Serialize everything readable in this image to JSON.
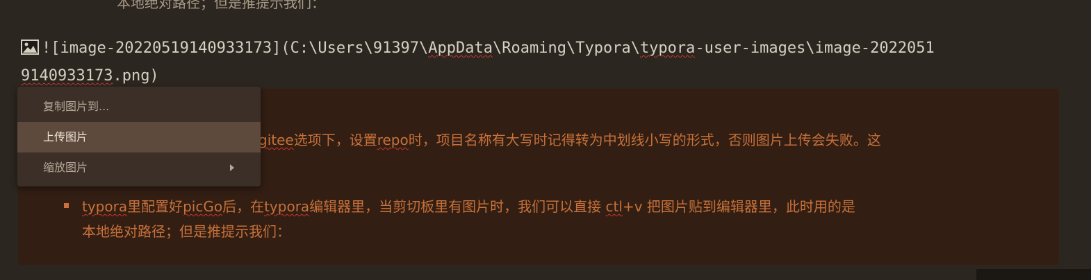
{
  "editor": {
    "top_partial_text": "本地绝对路径；但是推提示我们：",
    "image_source": {
      "icon": "image-icon",
      "line1_a": "![image-20220519140933173](C:\\Users\\91397\\",
      "line1_b": "AppData",
      "line1_c": "\\Roaming\\Typora\\",
      "line1_d": "typora",
      "line1_e": "-user-images\\image-2022051",
      "line2_a": "9140933173",
      "line2_b": ".png)"
    },
    "quote": {
      "line1_a": "gitee",
      "line1_b": "选项下，设置",
      "line1_c": "repo",
      "line1_d": "时，项目名称有大写时记得转为中划线小写的形式，否则图片上传会失败。这"
    },
    "bullet": {
      "line1_a": "typora",
      "line1_b": "里配置好",
      "line1_c": "picGo",
      "line1_d": "后，在",
      "line1_e": "typora",
      "line1_f": "编辑器里，当剪切板里有图片时，我们可以直接 ",
      "line1_g": "ctl",
      "line1_h": "+v 把图片贴到编辑器里，此时用的是",
      "line2": "本地绝对路径；但是推提示我们："
    }
  },
  "context_menu": {
    "items": [
      {
        "label": "复制图片到..."
      },
      {
        "label": "上传图片"
      },
      {
        "label": "缩放图片",
        "submenu_icon": "chevron-right-icon"
      }
    ]
  },
  "colors": {
    "editor_background": "#2c2620",
    "quote_background": "#321e13",
    "quote_text": "#c8713a",
    "source_text": "#d6cfc2",
    "spellcheck_underline": "#c8372d",
    "menu_background": "#3b2f27",
    "menu_highlight": "#5e4a3c"
  }
}
